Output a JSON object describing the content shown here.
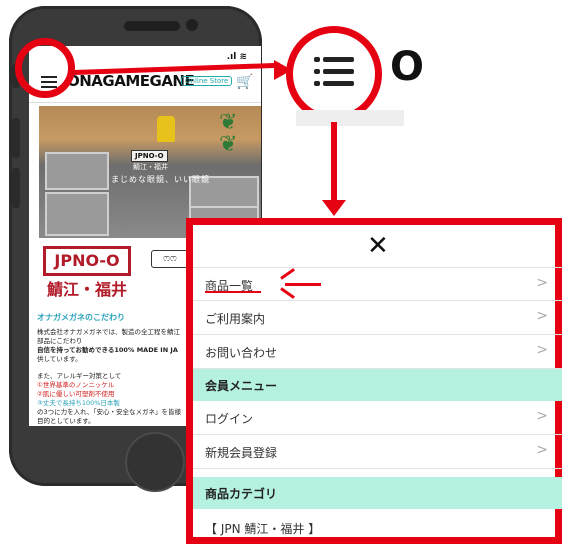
{
  "phone": {
    "status": ".ıl ≋",
    "header": {
      "logo_text": "ONAGAMEGANE",
      "badge": "Online Store",
      "cart_icon": "🛒"
    },
    "hero": {
      "brand": "JPNO-O",
      "location": "鯖江・福井",
      "catchphrase": "まじめな眼鏡、いい眼鏡"
    },
    "logos": {
      "jpn": "JPNO-O",
      "jpn_sub": "鯖江・福井",
      "mm": "ෆෆ",
      "mm_tail": "ノ"
    },
    "section_title": "オナガメガネのこだわり",
    "body_lines": [
      "株式会社オナガメガネでは、製造の全工程を鯖江",
      "部品にこだわり",
      "自信を持ってお勧めできる100% MADE IN JA",
      "供しています。",
      "",
      "また、アレルギー対策として",
      "①世界基準のノンニッケル",
      "②肌に優しい可塑剤不使用",
      "③丈夫で長持ち100%日本製",
      "の3つに力を入れ、「安心・安全なメガネ」を皆様",
      "目的としています。"
    ]
  },
  "callout": {
    "cut_letter": "O"
  },
  "menu": {
    "close_icon": "✕",
    "items": [
      {
        "label": "商品一覧",
        "chevron": ">"
      },
      {
        "label": "ご利用案内",
        "chevron": ">"
      },
      {
        "label": "お問い合わせ",
        "chevron": ">"
      }
    ],
    "member_section": "会員メニュー",
    "member_items": [
      {
        "label": "ログイン",
        "chevron": ">"
      },
      {
        "label": "新規会員登録",
        "chevron": ">"
      }
    ],
    "category_section": "商品カテゴリ",
    "category_items": [
      {
        "label": "【 JPN 鯖江・福井 】"
      }
    ]
  },
  "colors": {
    "accent_red": "#e50012",
    "section_mint": "#b5f1e0",
    "brand_red": "#b11b2a",
    "teal": "#2aa3b9"
  }
}
